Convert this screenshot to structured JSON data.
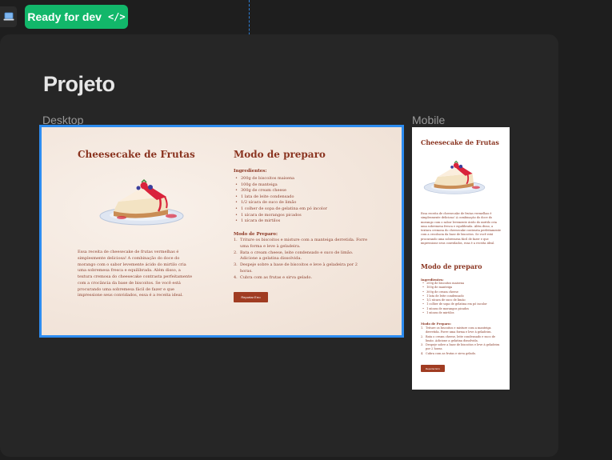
{
  "toolbar": {
    "device_icon": "laptop-icon",
    "ready_label": "Ready for dev",
    "ready_icon": "code-icon",
    "ready_icon_glyph": "</>",
    "ready_color": "#12b76a"
  },
  "project": {
    "title": "Projeto"
  },
  "frames": {
    "desktop_label": "Desktop",
    "mobile_label": "Mobile",
    "selection_color": "#2d8cf0"
  },
  "recipe": {
    "title": "Cheesecake de Frutas",
    "description": "Essa receita de cheesecake de frutas vermelhas é simplesmente deliciosa! A combinação do doce do morango com o sabor levemente ácido do mirtilo cria uma sobremesa fresca e equilibrada. Além disso, a textura cremosa do cheesecake contrasta perfeitamente com a crocância da base de biscoitos. Se você está procurando uma sobremesa fácil de fazer e que impressione seus convidados, essa é a receita ideal.",
    "prep_title": "Modo de preparo",
    "ingredients_heading": "Ingredientes:",
    "ingredients": [
      "200g de biscoitos maisena",
      "100g de manteiga",
      "300g de cream cheese",
      "1 lata de leite condensado",
      "1/2 xícara de suco de limão",
      "1 colher de sopa de gelatina em pó incolor",
      "1 xícara de morangos picados",
      "1 xícara de mirtilos"
    ],
    "method_heading": "Modo de Preparo:",
    "steps": [
      "Triture os biscoitos e misture com a manteiga derretida. Forre uma forma e leve à geladeira.",
      "Bata o cream cheese, leite condensado e suco de limão. Adicione a gelatina dissolvida.",
      "Despeje sobre a base de biscoitos e leve à geladeira por 2 horas.",
      "Cubra com as frutas e sirva gelado."
    ],
    "button_label": "Reportar Erro",
    "accent_color": "#a03c22"
  }
}
